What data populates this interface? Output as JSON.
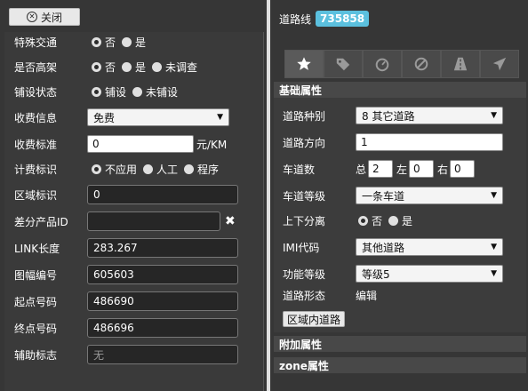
{
  "left": {
    "close_label": "关闭",
    "fields": {
      "special_traffic": {
        "label": "特殊交通",
        "options": [
          "否",
          "是"
        ],
        "selected": 0
      },
      "elevated": {
        "label": "是否高架",
        "options": [
          "否",
          "是",
          "未调查"
        ],
        "selected": 0
      },
      "paving": {
        "label": "铺设状态",
        "options": [
          "铺设",
          "未铺设"
        ],
        "selected": 0
      },
      "toll_info": {
        "label": "收费信息",
        "value": "免费"
      },
      "toll_standard": {
        "label": "收费标准",
        "value": "0",
        "unit": "元/KM"
      },
      "billing_flag": {
        "label": "计费标识",
        "options": [
          "不应用",
          "人工",
          "程序"
        ],
        "selected": 0
      },
      "area_flag": {
        "label": "区域标识",
        "value": "0"
      },
      "diff_product_id": {
        "label": "差分产品ID",
        "value": ""
      },
      "link_length": {
        "label": "LINK长度",
        "value": "283.267"
      },
      "map_sheet": {
        "label": "图幅编号",
        "value": "605603"
      },
      "start_node": {
        "label": "起点号码",
        "value": "486690"
      },
      "end_node": {
        "label": "终点号码",
        "value": "486696"
      },
      "aux_flag": {
        "label": "辅助标志",
        "placeholder": "无"
      }
    }
  },
  "right": {
    "title": "道路线",
    "badge": "735858",
    "tabs": [
      "star-icon",
      "tag-icon",
      "speedometer-icon",
      "ban-icon",
      "road-icon",
      "send-icon"
    ],
    "sections": {
      "basic": "基础属性",
      "extra": "附加属性",
      "zone": "zone属性"
    },
    "fields": {
      "road_type": {
        "label": "道路种别",
        "value": "8 其它道路"
      },
      "direction": {
        "label": "道路方向",
        "value": "1"
      },
      "lanes": {
        "label": "车道数",
        "total_label": "总",
        "total": "2",
        "left_label": "左",
        "left": "0",
        "right_label": "右",
        "right": "0"
      },
      "lane_class": {
        "label": "车道等级",
        "value": "一条车道"
      },
      "divided": {
        "label": "上下分离",
        "options": [
          "否",
          "是"
        ],
        "selected": 0
      },
      "imi": {
        "label": "IMI代码",
        "value": "其他道路"
      },
      "func_class": {
        "label": "功能等级",
        "value": "等级5"
      },
      "road_form": {
        "label": "道路形态",
        "value": "编辑"
      }
    },
    "area_road_button": "区域内道路"
  }
}
